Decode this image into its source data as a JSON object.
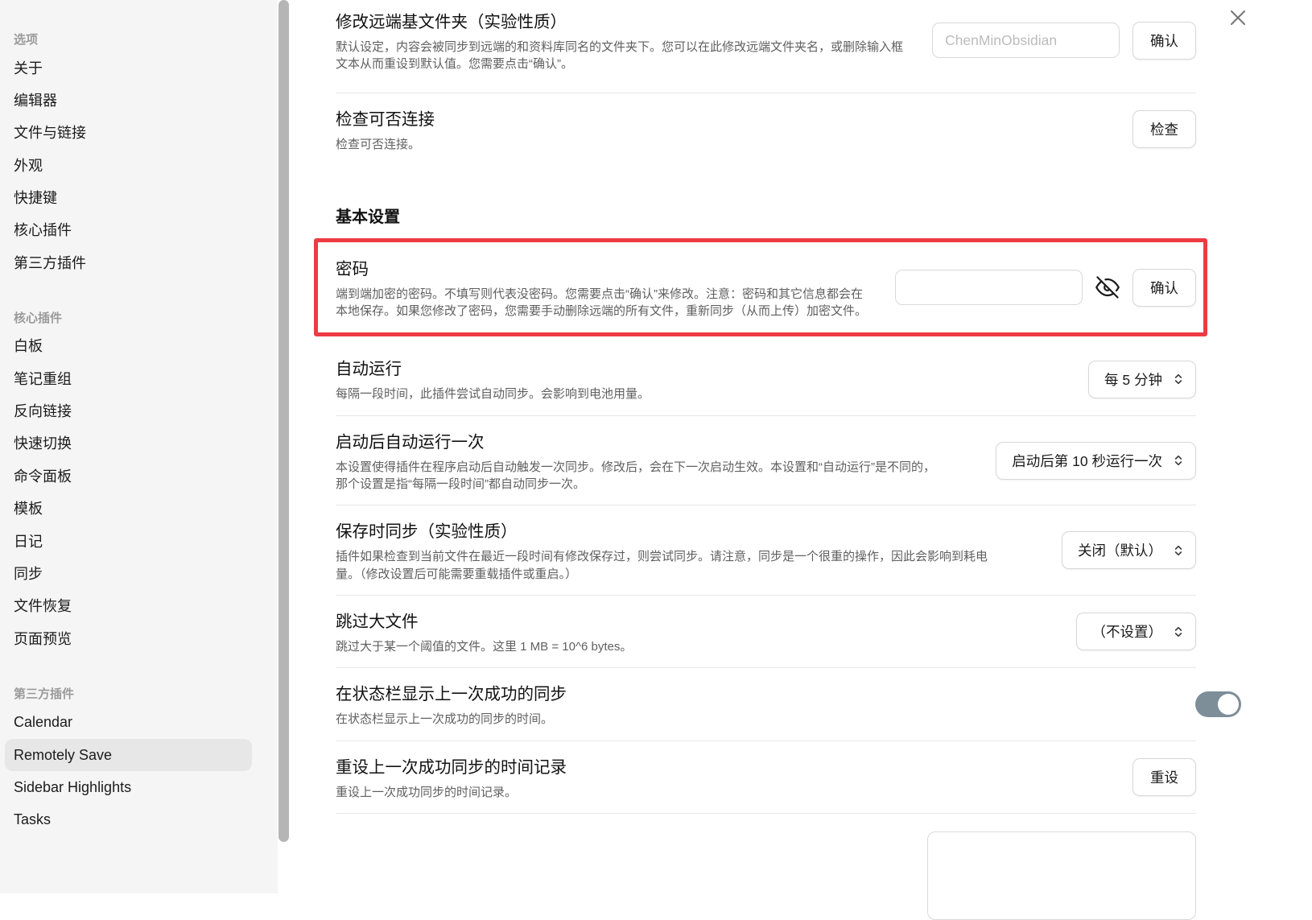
{
  "window": {
    "close_icon": "✕"
  },
  "colors": {
    "accent_red": "#ee3b43",
    "toggle_on": "#7d8e99",
    "sidebar_bg": "#f5f5f5",
    "active_item_bg": "#e7e7e7"
  },
  "sidebar": {
    "groups": [
      {
        "header": "选项",
        "items": [
          "关于",
          "编辑器",
          "文件与链接",
          "外观",
          "快捷键",
          "核心插件",
          "第三方插件"
        ]
      },
      {
        "header": "核心插件",
        "items": [
          "白板",
          "笔记重组",
          "反向链接",
          "快速切换",
          "命令面板",
          "模板",
          "日记",
          "同步",
          "文件恢复",
          "页面预览"
        ]
      },
      {
        "header": "第三方插件",
        "items": [
          "Calendar",
          "Remotely Save",
          "Sidebar Highlights",
          "Tasks"
        ],
        "active_item": "Remotely Save"
      }
    ]
  },
  "main": {
    "section_heading": "基本设置",
    "rows": {
      "remote_base_dir": {
        "title": "修改远端基文件夹（实验性质）",
        "desc": "默认设定，内容会被同步到远端的和资料库同名的文件夹下。您可以在此修改远端文件夹名，或删除输入框文本从而重设到默认值。您需要点击“确认”。",
        "input_placeholder": "ChenMinObsidian",
        "confirm_label": "确认"
      },
      "check_connectivity": {
        "title": "检查可否连接",
        "desc": "检查可否连接。",
        "button_label": "检查"
      },
      "password": {
        "title": "密码",
        "desc": "端到端加密的密码。不填写则代表没密码。您需要点击“确认”来修改。注意：密码和其它信息都会在本地保存。如果您修改了密码，您需要手动删除远端的所有文件，重新同步（从而上传）加密文件。",
        "input_value": "",
        "confirm_label": "确认"
      },
      "auto_run": {
        "title": "自动运行",
        "desc": "每隔一段时间，此插件尝试自动同步。会影响到电池用量。",
        "value": "每 5 分钟"
      },
      "run_once_on_start": {
        "title": "启动后自动运行一次",
        "desc": "本设置使得插件在程序启动后自动触发一次同步。修改后，会在下一次启动生效。本设置和“自动运行”是不同的，那个设置是指“每隔一段时间”都自动同步一次。",
        "value": "启动后第 10 秒运行一次"
      },
      "sync_on_save": {
        "title": "保存时同步（实验性质）",
        "desc": "插件如果检查到当前文件在最近一段时间有修改保存过，则尝试同步。请注意，同步是一个很重的操作，因此会影响到耗电量。（修改设置后可能需要重载插件或重启。）",
        "value": "关闭（默认）"
      },
      "skip_large_files": {
        "title": "跳过大文件",
        "desc": "跳过大于某一个阈值的文件。这里 1 MB = 10^6 bytes。",
        "value": "（不设置）"
      },
      "status_bar_last_sync": {
        "title": "在状态栏显示上一次成功的同步",
        "desc": "在状态栏显示上一次成功的同步的时间。",
        "toggle_state": "on"
      },
      "reset_last_sync_time": {
        "title": "重设上一次成功同步的时间记录",
        "desc": "重设上一次成功同步的时间记录。",
        "button_label": "重设"
      }
    }
  }
}
